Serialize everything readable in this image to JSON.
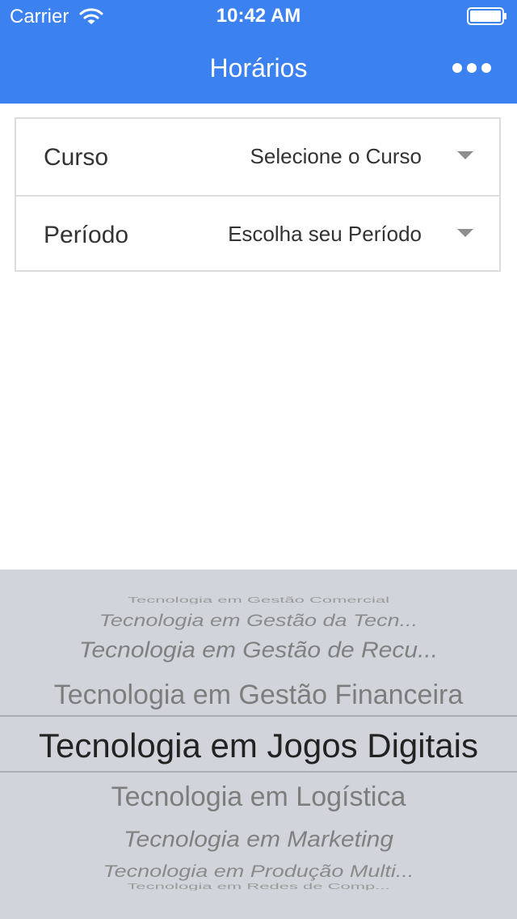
{
  "status_bar": {
    "carrier": "Carrier",
    "time": "10:42 AM"
  },
  "nav": {
    "title": "Horários",
    "more_icon": "ellipsis-icon"
  },
  "form": {
    "rows": [
      {
        "label": "Curso",
        "value": "Selecione o Curso",
        "icon": "caret-down-icon"
      },
      {
        "label": "Período",
        "value": "Escolha seu Período",
        "icon": "caret-down-icon"
      }
    ]
  },
  "picker": {
    "items": [
      "Tecnologia em Gestão Comercial",
      "Tecnologia em Gestão da Tecn...",
      "Tecnologia em Gestão de Recu...",
      "Tecnologia em Gestão Financeira",
      "Tecnologia em Jogos Digitais",
      "Tecnologia em Logística",
      "Tecnologia em Marketing",
      "Tecnologia em Produção Multi...",
      "Tecnologia em Redes de Comp..."
    ],
    "selected_index": 4
  },
  "colors": {
    "accent": "#3b82f0",
    "picker_bg": "#d1d5db"
  }
}
